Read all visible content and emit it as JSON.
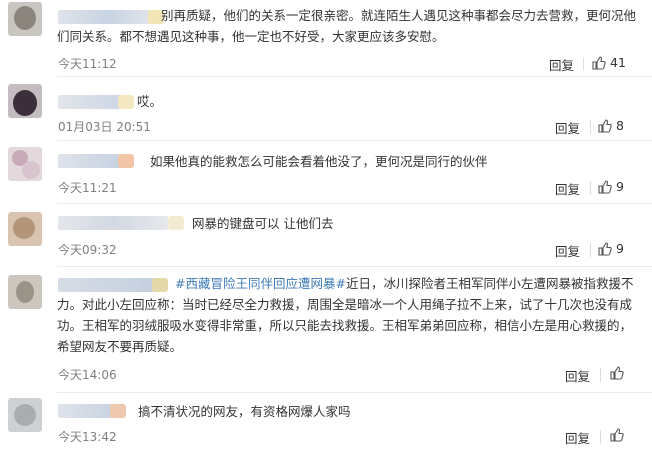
{
  "comments": [
    {
      "text": "别再质疑，他们的关系一定很亲密。就连陌生人遇见这种事都会尽力去营救，更何况他们同关系。都不想遇见这种事，他一定也不好受，大家更应该多安慰。",
      "time": "今天11:12",
      "reply": "回复",
      "likes": "41"
    },
    {
      "text": "哎。",
      "time": "01月03日 20:51",
      "reply": "回复",
      "likes": "8"
    },
    {
      "text": "如果他真的能救怎么可能会看着他没了，更何况是同行的伙伴",
      "time": "今天11:21",
      "reply": "回复",
      "likes": "9"
    },
    {
      "text": "网暴的键盘可以 让他们去",
      "time": "今天09:32",
      "reply": "回复",
      "likes": "9"
    },
    {
      "tag": "#西藏冒险王同伴回应遭网暴#",
      "text": "近日，冰川探险者王相军同伴小左遭网暴被指救援不力。对此小左回应称：当时已经尽全力救援，周围全是暗冰一个人用绳子拉不上来，试了十几次也没有成功。王相军的羽绒服吸水变得非常重，所以只能去找救援。王相军弟弟回应称，相信小左是用心救援的，希望网友不要再质疑。",
      "time": "今天14:06",
      "reply": "回复",
      "likes": ""
    },
    {
      "text": "搞不清状况的网友，有资格网爆人家吗",
      "time": "今天13:42",
      "reply": "回复",
      "likes": ""
    }
  ],
  "colors": {
    "tag": "#3d7bb7",
    "meta": "#808080",
    "divider": "#ececec"
  },
  "icons": [
    "thumbs-up-icon"
  ]
}
